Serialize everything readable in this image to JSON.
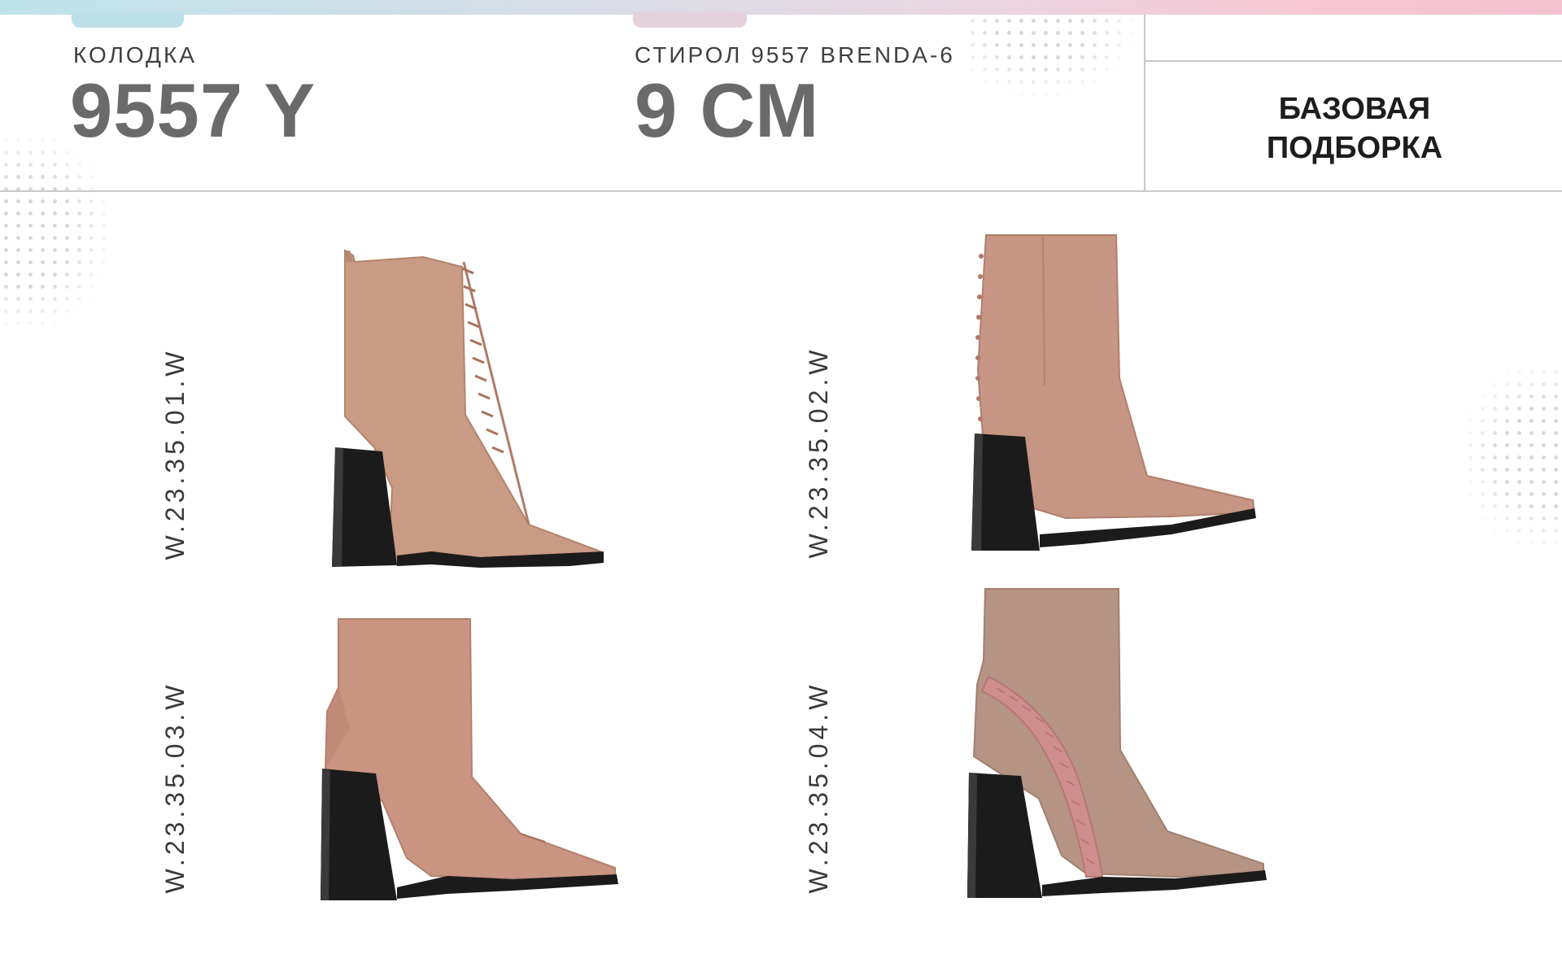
{
  "header": {
    "last_label": "КОЛОДКА",
    "last_value": "9557 Y",
    "heel_label": "СТИРОЛ 9557 BRENDA-6",
    "heel_value": "9 СМ",
    "collection_line1": "БАЗОВАЯ",
    "collection_line2": "ПОДБОРКА"
  },
  "colors": {
    "leather": "#c99a84",
    "leather_dark": "#b7876f",
    "suede": "#b69484",
    "croc": "#cf8e8e",
    "heel": "#1b1b1b",
    "heading_gray": "#6a6a6a"
  },
  "products": [
    {
      "code": "W.23.35.01.W",
      "icon": "lace-up-ankle-boot-icon"
    },
    {
      "code": "W.23.35.02.W",
      "icon": "studded-ankle-boot-icon"
    },
    {
      "code": "W.23.35.03.W",
      "icon": "smooth-ankle-boot-icon"
    },
    {
      "code": "W.23.35.04.W",
      "icon": "croc-panel-ankle-boot-icon"
    }
  ]
}
